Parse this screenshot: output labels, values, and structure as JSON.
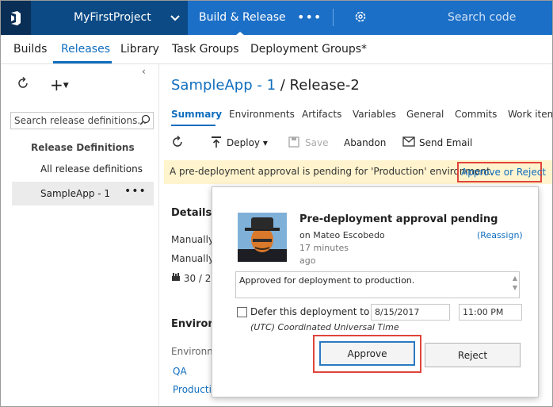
{
  "topbar": {
    "project_name": "MyFirstProject",
    "hub_title": "Build & Release",
    "more": "•••",
    "search_placeholder": "Search code"
  },
  "subnav": {
    "items": [
      "Builds",
      "Releases",
      "Library",
      "Task Groups",
      "Deployment Groups*"
    ],
    "active": "Releases"
  },
  "left": {
    "collapse": "‹",
    "search_placeholder": "Search release definitions...",
    "section_title": "Release Definitions",
    "all_label": "All release definitions",
    "selected_label": "SampleApp - 1",
    "more": "•••"
  },
  "main": {
    "breadcrumb_link": "SampleApp - 1",
    "breadcrumb_rest": " / Release-2",
    "tabs": [
      "Summary",
      "Environments",
      "Artifacts",
      "Variables",
      "General",
      "Commits",
      "Work items"
    ],
    "toolbar": {
      "deploy": "Deploy",
      "save": "Save",
      "abandon": "Abandon",
      "send_email": "Send Email"
    },
    "banner_message": "A pre-deployment approval is pending for 'Production' environment.",
    "banner_link": "Approve or Reject",
    "details_title": "Details",
    "details_line1": "Manually t",
    "details_line2": "Manually",
    "details_line3": "30 / 2",
    "environments_title": "Environm",
    "environments_col": "Environm",
    "env_qa": "QA",
    "env_production": "Productio"
  },
  "popup": {
    "title": "Pre-deployment approval pending",
    "on_user": "on Mateo Escobedo",
    "reassign": "(Reassign)",
    "minutes": "17 minutes",
    "ago": "ago",
    "comment": "Approved for deployment to production.",
    "defer_label": "Defer this deployment to",
    "date": "8/15/2017",
    "time": "11:00 PM",
    "timezone": "(UTC) Coordinated Universal Time",
    "approve": "Approve",
    "reject": "Reject"
  },
  "colors": {
    "topbar_dark": "#0b3c6e",
    "hub_blue": "#1c6fc6",
    "link_blue": "#106ebe",
    "highlight_red": "#e0453a",
    "banner_yellow": "#fff4ce"
  }
}
